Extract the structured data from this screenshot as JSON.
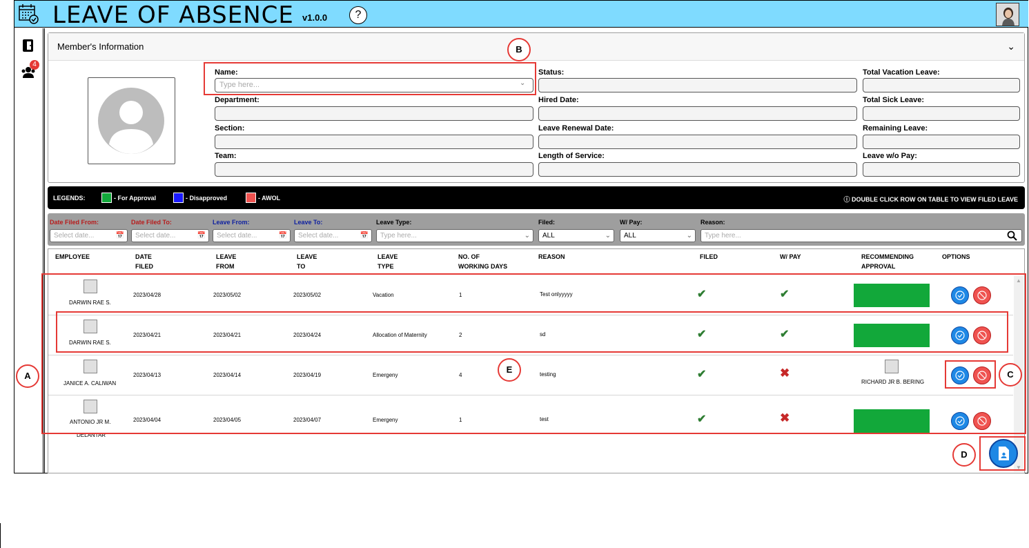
{
  "header": {
    "title": "LEAVE OF ABSENCE",
    "version": "v1.0.0",
    "help": "?"
  },
  "sidebar": {
    "badge_count": "4"
  },
  "member": {
    "title": "Member's Information",
    "name_label": "Name:",
    "name_placeholder": "Type here...",
    "department_label": "Department:",
    "section_label": "Section:",
    "team_label": "Team:",
    "status_label": "Status:",
    "hired_label": "Hired Date:",
    "renewal_label": "Leave Renewal Date:",
    "service_label": "Length of Service:",
    "vacation_label": "Total Vacation Leave:",
    "sick_label": "Total Sick Leave:",
    "remaining_label": "Remaining Leave:",
    "wopay_label": "Leave w/o Pay:"
  },
  "legend": {
    "title": "LEGENDS:",
    "items": [
      {
        "label": "- For Approval",
        "color": "#12a83a"
      },
      {
        "label": "- Disapproved",
        "color": "#1a1aff"
      },
      {
        "label": "- AWOL",
        "color": "#ef5350"
      }
    ],
    "hint": "DOUBLE CLICK ROW ON TABLE TO VIEW FILED LEAVE"
  },
  "filters": {
    "date_filed_from": "Date Filed From:",
    "date_filed_to": "Date Filed To:",
    "leave_from": "Leave From:",
    "leave_to": "Leave To:",
    "leave_type": "Leave Type:",
    "filed": "Filed:",
    "wpay": "W/ Pay:",
    "reason": "Reason:",
    "date_placeholder": "Select date...",
    "type_placeholder": "Type here...",
    "filed_value": "ALL",
    "wpay_value": "ALL",
    "reason_placeholder": "Type here..."
  },
  "table": {
    "headers": {
      "employee": "EMPLOYEE",
      "date_filed_1": "DATE",
      "date_filed_2": "FILED",
      "leave_from_1": "LEAVE",
      "leave_from_2": "FROM",
      "leave_to_1": "LEAVE",
      "leave_to_2": "TO",
      "leave_type_1": "LEAVE",
      "leave_type_2": "TYPE",
      "days_1": "NO. OF",
      "days_2": "WORKING DAYS",
      "reason": "REASON",
      "filed": "FILED",
      "wpay": "W/ PAY",
      "rec_1": "RECOMMENDING",
      "rec_2": "APPROVAL",
      "options": "OPTIONS"
    },
    "rows": [
      {
        "employee": "DARWIN RAE S.",
        "employee2": "",
        "date_filed": "2023/04/28",
        "leave_from": "2023/05/02",
        "leave_to": "2023/05/02",
        "leave_type": "Vacation",
        "days": "1",
        "reason": "Test onlyyyyy",
        "filed": true,
        "wpay": true,
        "recommender": ""
      },
      {
        "employee": "DARWIN RAE S.",
        "employee2": "",
        "date_filed": "2023/04/21",
        "leave_from": "2023/04/21",
        "leave_to": "2023/04/24",
        "leave_type": "Allocation of Maternity",
        "days": "2",
        "reason": "sd",
        "filed": true,
        "wpay": true,
        "recommender": ""
      },
      {
        "employee": "JANICE A. CALIWAN",
        "employee2": "",
        "date_filed": "2023/04/13",
        "leave_from": "2023/04/14",
        "leave_to": "2023/04/19",
        "leave_type": "Emergeny",
        "days": "4",
        "reason": "testing",
        "filed": true,
        "wpay": false,
        "recommender": "RICHARD JR B. BERING"
      },
      {
        "employee": "ANTONIO JR M.",
        "employee2": "DELANTAR",
        "date_filed": "2023/04/04",
        "leave_from": "2023/04/05",
        "leave_to": "2023/04/07",
        "leave_type": "Emergeny",
        "days": "1",
        "reason": "test",
        "filed": true,
        "wpay": false,
        "recommender": ""
      }
    ]
  },
  "annotations": {
    "a": "A",
    "b": "B",
    "c": "C",
    "d": "D",
    "e": "E"
  },
  "colors": {
    "topbar": "#7fdbff",
    "approve_green": "#12a83a",
    "button_blue": "#1e88e5",
    "button_red": "#ef5350",
    "annotation_red": "#e53935"
  }
}
